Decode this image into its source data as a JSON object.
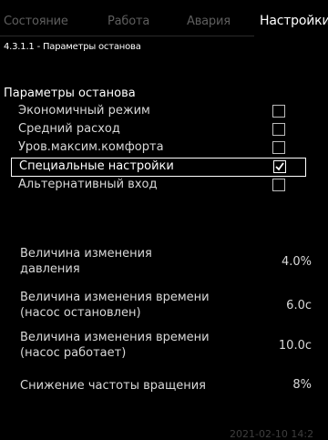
{
  "tabs": [
    {
      "label": "Состояние"
    },
    {
      "label": "Работа"
    },
    {
      "label": "Авария"
    },
    {
      "label": "Настройки"
    }
  ],
  "path": "4.3.1.1 - Параметры останова",
  "section_title": "Параметры останова",
  "options": [
    {
      "label": "Экономичный режим",
      "checked": false,
      "selected": false
    },
    {
      "label": "Средний расход",
      "checked": false,
      "selected": false
    },
    {
      "label": "Уров.максим.комфорта",
      "checked": false,
      "selected": false
    },
    {
      "label": "Специальные настройки",
      "checked": true,
      "selected": true
    },
    {
      "label": "Альтернативный вход",
      "checked": false,
      "selected": false
    }
  ],
  "params": [
    {
      "line1": "Величина изменения",
      "line2": "давления",
      "value": "4.0%"
    },
    {
      "line1": "Величина изменения времени",
      "line2": "(насос остановлен)",
      "value": "6.0с"
    },
    {
      "line1": "Величина изменения времени",
      "line2": "(насос работает)",
      "value": "10.0с"
    },
    {
      "line1": "Снижение частоты вращения",
      "line2": "",
      "value": "8%"
    }
  ],
  "footer_time": "2021-02-10 14:2",
  "colors": {
    "background": "#000000",
    "text": "#ffffff",
    "inactive_tab": "#5e5e5e"
  }
}
